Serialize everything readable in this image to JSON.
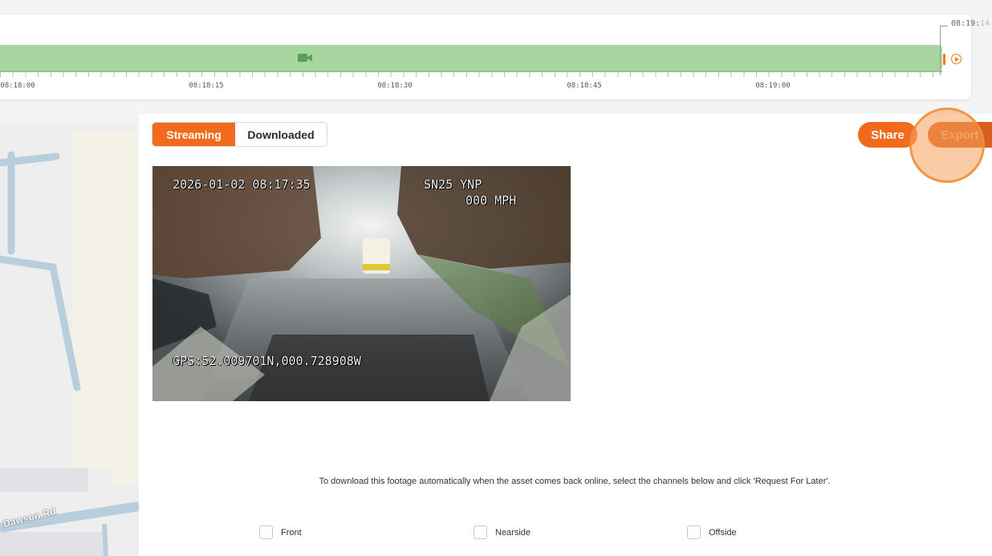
{
  "timeline": {
    "tick_labels": [
      "08:18:00",
      "08:18:15",
      "08:18:30",
      "08:18:45",
      "08:19:00"
    ],
    "end_time_main": "08:19:",
    "end_time_dim": "14"
  },
  "tabs": {
    "streaming": "Streaming",
    "downloaded": "Downloaded"
  },
  "actions": {
    "share": "Share",
    "export": "Export"
  },
  "video": {
    "timestamp": "2026-01-02 08:17:35",
    "vehicle_reg": "SN25 YNP",
    "speed": "000 MPH",
    "gps": "GPS:52.009701N,000.728908W"
  },
  "map": {
    "road_label": "Dawson Rd"
  },
  "download": {
    "instruction": "To download this footage automatically when the asset comes back online, select the channels below and click 'Request For Later'.",
    "channels": [
      "Front",
      "Nearside",
      "Offside"
    ]
  },
  "colors": {
    "accent": "#f26b1d",
    "track": "#a8d5a0"
  }
}
